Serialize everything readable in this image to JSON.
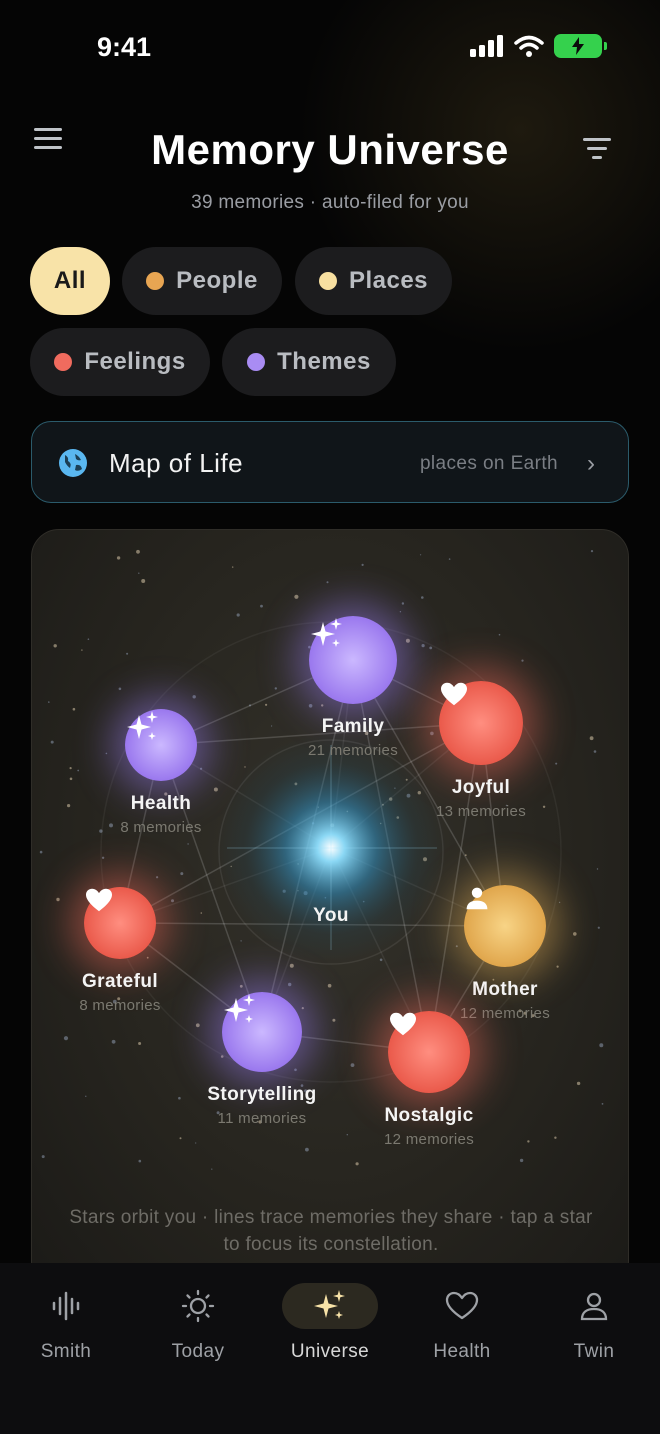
{
  "status": {
    "time": "9:41"
  },
  "header": {
    "title": "Memory Universe",
    "subtitle": "39 memories · auto-filed for you"
  },
  "filters": [
    {
      "label": "All",
      "dot": null,
      "active": true
    },
    {
      "label": "People",
      "dot": "#e8a552"
    },
    {
      "label": "Places",
      "dot": "#f7dfa0"
    },
    {
      "label": "Feelings",
      "dot": "#f06b5e"
    },
    {
      "label": "Themes",
      "dot": "#a98cf3"
    }
  ],
  "map_card": {
    "label": "Map of Life",
    "hint": "places on Earth"
  },
  "universe": {
    "center": {
      "name": "You"
    },
    "nodes": [
      {
        "name": "Family",
        "count": "21 memories",
        "kind": "theme",
        "icon": "sparkles-icon"
      },
      {
        "name": "Joyful",
        "count": "13 memories",
        "kind": "feeling",
        "icon": "heart-icon"
      },
      {
        "name": "Health",
        "count": "8 memories",
        "kind": "theme",
        "icon": "sparkles-icon"
      },
      {
        "name": "Grateful",
        "count": "8 memories",
        "kind": "feeling",
        "icon": "heart-icon"
      },
      {
        "name": "Mother",
        "count": "12 memories",
        "kind": "person",
        "icon": "person-icon"
      },
      {
        "name": "Storytelling",
        "count": "11 memories",
        "kind": "theme",
        "icon": "sparkles-icon"
      },
      {
        "name": "Nostalgic",
        "count": "12 memories",
        "kind": "feeling",
        "icon": "heart-icon"
      }
    ],
    "caption": "Stars orbit you · lines trace memories they share · tap a star to focus its constellation."
  },
  "tabs": [
    {
      "label": "Smith",
      "icon": "waveform-icon"
    },
    {
      "label": "Today",
      "icon": "sun-icon"
    },
    {
      "label": "Universe",
      "icon": "sparkles-icon",
      "active": true
    },
    {
      "label": "Health",
      "icon": "heart-outline-icon"
    },
    {
      "label": "Twin",
      "icon": "person-outline-icon"
    }
  ],
  "colors": {
    "theme": "#a98cf3",
    "feeling": "#f06b5e",
    "person": "#e8b45a",
    "center": "#5ec8f2",
    "accent": "#f8e3a8"
  }
}
